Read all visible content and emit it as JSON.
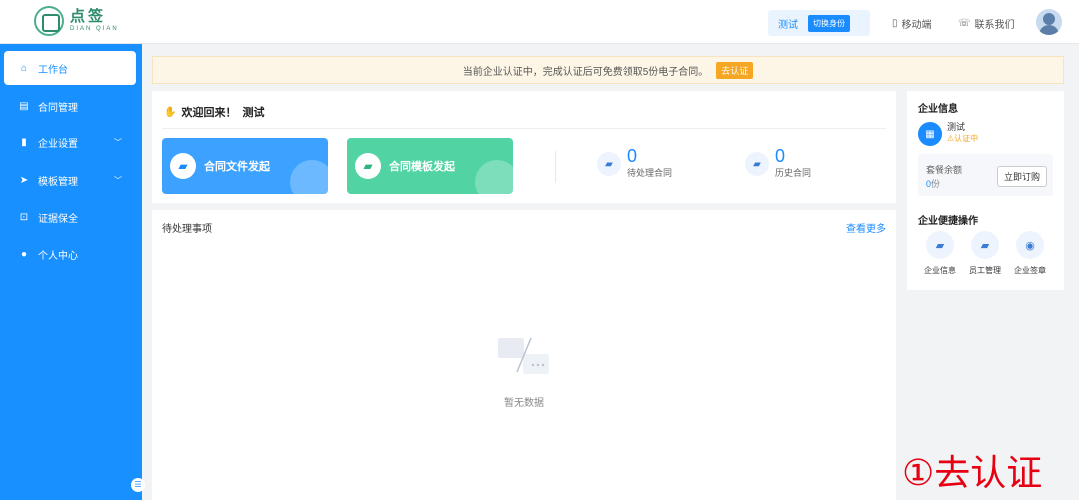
{
  "header": {
    "logo_cn": "点签",
    "logo_en": "DIAN QIAN",
    "identity_name": "测试",
    "switch_label": "切换身份",
    "mobile_label": "移动端",
    "contact_label": "联系我们"
  },
  "sidebar": {
    "items": [
      {
        "label": "工作台",
        "icon": "home-icon"
      },
      {
        "label": "合同管理",
        "icon": "document-icon"
      },
      {
        "label": "企业设置",
        "icon": "bar-chart-icon"
      },
      {
        "label": "模板管理",
        "icon": "send-icon"
      },
      {
        "label": "证据保全",
        "icon": "lock-icon"
      },
      {
        "label": "个人中心",
        "icon": "user-icon"
      }
    ],
    "active_index": 0
  },
  "notice": {
    "text": "当前企业认证中，完成认证后可免费领取5份电子合同。",
    "button_label": "去认证"
  },
  "welcome": {
    "title": "欢迎回来！",
    "user": "测试",
    "actions": [
      {
        "label": "合同文件发起",
        "color": "#3da2ff"
      },
      {
        "label": "合同模板发起",
        "color": "#52d3a4"
      }
    ],
    "stats": [
      {
        "value": "0",
        "label": "待处理合同"
      },
      {
        "value": "0",
        "label": "历史合同"
      }
    ]
  },
  "pending": {
    "title": "待处理事项",
    "more_label": "查看更多",
    "empty_text": "暂无数据"
  },
  "enterprise": {
    "title": "企业信息",
    "name": "测试",
    "status": "认证中",
    "plan_label": "套餐余额",
    "plan_value": "0",
    "plan_unit": "份",
    "subscribe_label": "立即订购"
  },
  "quick_ops": {
    "title": "企业便捷操作",
    "items": [
      {
        "label": "企业信息",
        "icon": "building-icon"
      },
      {
        "label": "员工管理",
        "icon": "team-icon"
      },
      {
        "label": "企业签章",
        "icon": "seal-icon"
      }
    ]
  },
  "caption": "①去认证",
  "colors": {
    "primary": "#1890ff",
    "warning": "#f5a623",
    "caption": "#e60012"
  }
}
